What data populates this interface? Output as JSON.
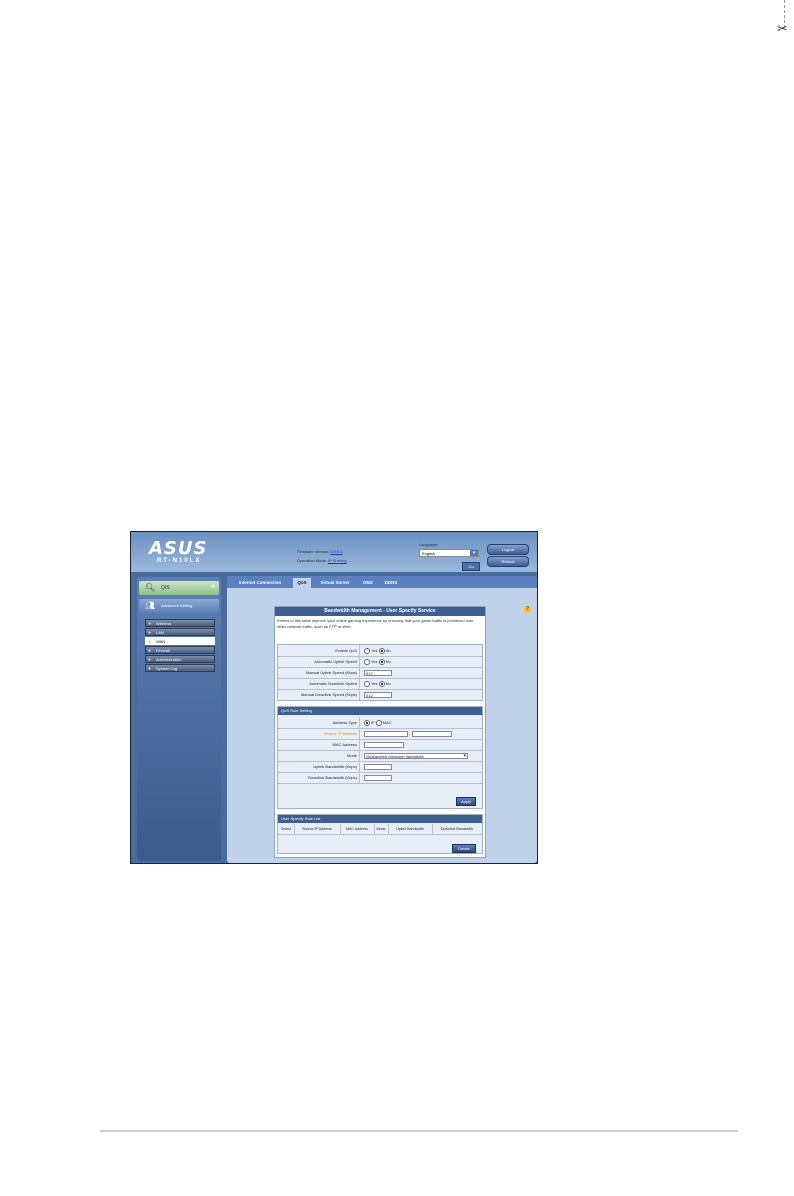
{
  "router": {
    "brand": "ASUS",
    "model": "RT-N10LX",
    "firmware_label": "Firmware Version:",
    "firmware_value": "3.0.0.1",
    "opmode_label": "Operation Mode:",
    "opmode_value": "IP Sharing",
    "language_label": "Language:",
    "language_value": "English",
    "language_apply": "Go",
    "logout": "Logout",
    "reboot": "Reboot"
  },
  "sidebar": {
    "qis": "QIS",
    "advanced": "Advanced Setting",
    "items": [
      {
        "label": "Wireless"
      },
      {
        "label": "LAN"
      },
      {
        "label": "WAN"
      },
      {
        "label": "Firewall"
      },
      {
        "label": "Administration"
      },
      {
        "label": "System Log"
      }
    ]
  },
  "tabs": [
    {
      "label": "Internet Connection"
    },
    {
      "label": "QoS"
    },
    {
      "label": "Virtual Server"
    },
    {
      "label": "DMZ"
    },
    {
      "label": "DDNS"
    }
  ],
  "panel": {
    "title": "Bandwidth Management - User Specify Service",
    "description": "Entries in this table improve your online gaming experience by ensuring that your game traffic is prioritized over other network traffic, such as FTP or Web.",
    "rows": [
      {
        "label": "Enable QoS",
        "yes": "Yes",
        "no": "No"
      },
      {
        "label": "Automatic Uplink Speed",
        "yes": "Yes",
        "no": "No"
      },
      {
        "label": "Manual Uplink Speed (Kbps)",
        "value": "512"
      },
      {
        "label": "Automatic Downlink Speed",
        "yes": "Yes",
        "no": "No"
      },
      {
        "label": "Manual Downlink Speed (Kbps)",
        "value": "512"
      }
    ],
    "rule_header": "QoS Rule Setting",
    "rule_rows": [
      {
        "label": "Address Type",
        "opt1": "IP",
        "opt2": "MAC"
      },
      {
        "label": "Source IP Address",
        "sep": "-"
      },
      {
        "label": "MAC Address"
      },
      {
        "label": "Mode",
        "value": "Guaranteed minimum bandwidth"
      },
      {
        "label": "Uplink Bandwidth (Kbps)"
      },
      {
        "label": "Downlink Bandwidth (Kbps)"
      }
    ],
    "apply": "Apply",
    "list_header": "User Specify Rule List",
    "list_columns": [
      "Select",
      "Source IP Address",
      "MAC Address",
      "Mode",
      "Uplink Bandwidth",
      "Downlink Bandwidth"
    ],
    "delete": "Delete"
  },
  "help_icon": "?"
}
